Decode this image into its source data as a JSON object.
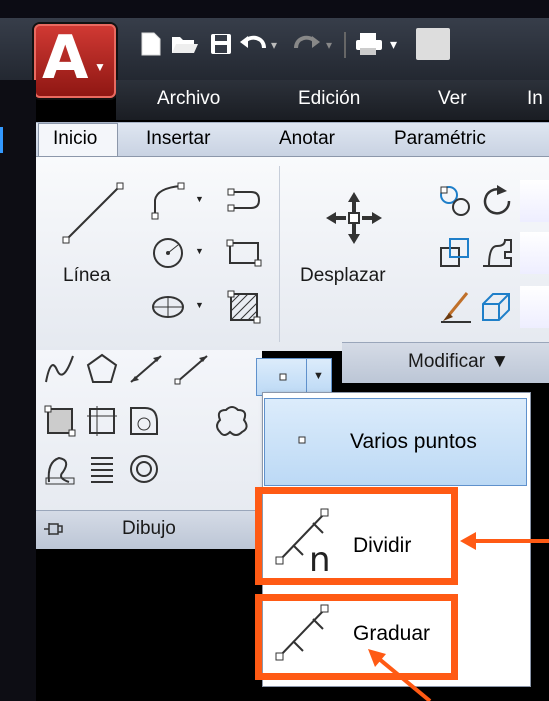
{
  "menubar": {
    "items": [
      "Archivo",
      "Edición",
      "Ver",
      "In"
    ]
  },
  "ribbon_tabs": [
    "Inicio",
    "Insertar",
    "Anotar",
    "Paramétric"
  ],
  "draw_panel": {
    "line_label": "Línea",
    "title": "Dibujo"
  },
  "modify_panel": {
    "move_label": "Desplazar",
    "title": "Modificar ▼"
  },
  "point_dropdown": {
    "items": [
      "Varios puntos",
      "Dividir",
      "Graduar"
    ]
  },
  "colors": {
    "highlight": "#ff5a14",
    "selected_bg": "#c9e1f8",
    "app_red": "#c42a24"
  }
}
